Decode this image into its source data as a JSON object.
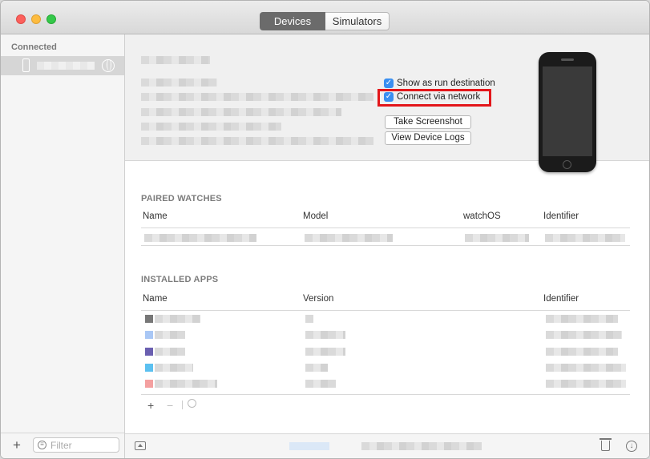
{
  "toolbar": {
    "tabs": [
      {
        "label": "Devices",
        "active": true
      },
      {
        "label": "Simulators",
        "active": false
      }
    ]
  },
  "sidebar": {
    "heading": "Connected",
    "filter_placeholder": "Filter"
  },
  "device": {
    "show_run_destination_label": "Show as run destination",
    "show_run_destination_checked": true,
    "connect_network_label": "Connect via network",
    "connect_network_checked": true,
    "take_screenshot_label": "Take Screenshot",
    "view_logs_label": "View Device Logs"
  },
  "paired_watches": {
    "title": "PAIRED WATCHES",
    "columns": [
      "Name",
      "Model",
      "watchOS",
      "Identifier"
    ]
  },
  "installed_apps": {
    "title": "INSTALLED APPS",
    "columns": [
      "Name",
      "Version",
      "Identifier"
    ]
  },
  "colors": {
    "accent": "#3a8ff1",
    "highlight": "#e3161a",
    "selected_segment": "#6b6b6b"
  },
  "icons": [
    "close-icon",
    "minimize-icon",
    "zoom-icon",
    "iphone-icon",
    "globe-icon",
    "filter-icon",
    "plus-icon",
    "minus-icon",
    "gear-icon",
    "panel-toggle-icon",
    "trash-icon",
    "download-icon"
  ]
}
